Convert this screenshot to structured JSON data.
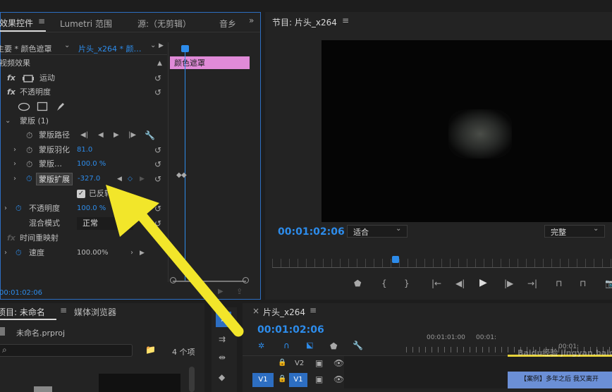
{
  "effects_panel": {
    "tabs": [
      "效果控件",
      "Lumetri 范围",
      "源:（无剪辑）",
      "音乡"
    ],
    "master": "主要 * 颜色遮罩",
    "clip": "片头_x264 * 颜…",
    "section": "视频效果",
    "items": {
      "motion": "运动",
      "opacity": "不透明度",
      "mask": "蒙版 (1)",
      "mask_path": "蒙版路径",
      "mask_feather": "蒙版羽化",
      "mask_feather_value": "81.0",
      "mask_opacity": "蒙版…",
      "mask_opacity_value": "100.0 %",
      "mask_expansion": "蒙版扩展",
      "mask_expansion_value": "-327.0",
      "inverted": "已反转",
      "opacity2": "不透明度",
      "opacity2_value": "100.0 %",
      "blend_mode": "混合模式",
      "blend_mode_value": "正常",
      "time_remap": "时间重映射",
      "speed": "速度",
      "speed_value": "100.00%"
    },
    "clip_label": "颜色遮罩",
    "timecode": "00:01:02:06"
  },
  "program": {
    "title": "节目: 片头_x264",
    "timecode": "00:01:02:06",
    "fit": "适合",
    "quality": "完整"
  },
  "project": {
    "tabs": [
      "项目: 未命名",
      "媒体浏览器"
    ],
    "file": "未命名.prproj",
    "count": "4 个项"
  },
  "timeline": {
    "title": "片头_x264",
    "timecode": "00:01:02:06",
    "ruler": [
      "00:01:01:00",
      "00:01:",
      "00:01:"
    ],
    "tracks": [
      {
        "name": "V2",
        "label": "V2"
      },
      {
        "name": "V1",
        "label": "V1",
        "src": "V1"
      }
    ],
    "clip_text": "【案例】多年之后 我又离开"
  },
  "watermark": "Baidu经验 jingyan.baidu.com"
}
